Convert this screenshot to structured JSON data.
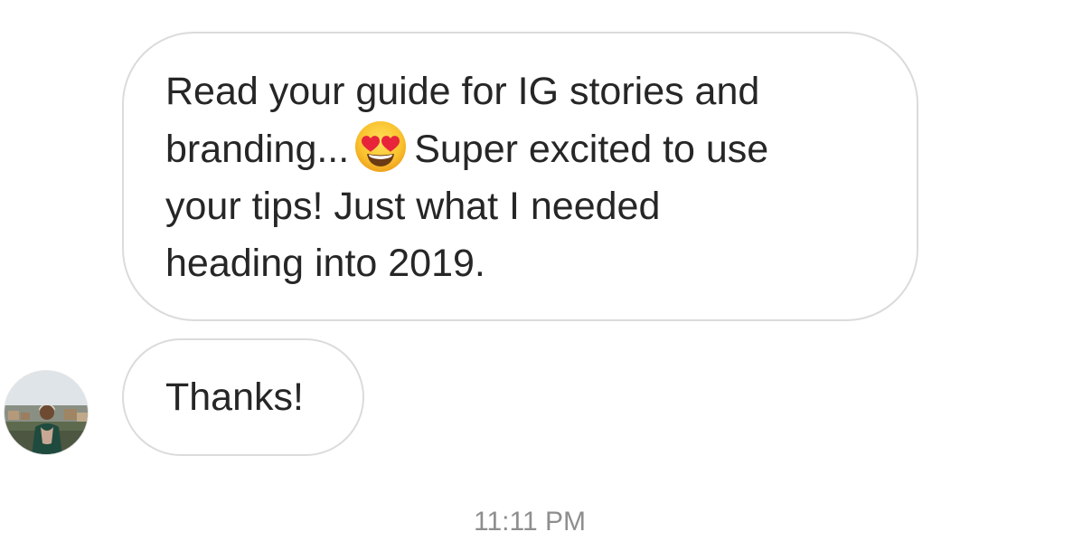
{
  "messages": [
    {
      "lines": [
        "Read your guide for IG stories and",
        "branding...",
        "Super excited to use",
        "your tips! Just what I needed",
        "heading into 2019."
      ],
      "emoji": "smiling-face-with-heart-eyes"
    },
    {
      "text": "Thanks!"
    }
  ],
  "sender_avatar": "avatar-photo",
  "timestamp": "11:11 PM",
  "colors": {
    "bubble_border": "#dbdbdb",
    "text": "#262626",
    "timestamp": "#8e8e8e",
    "background": "#ffffff"
  }
}
